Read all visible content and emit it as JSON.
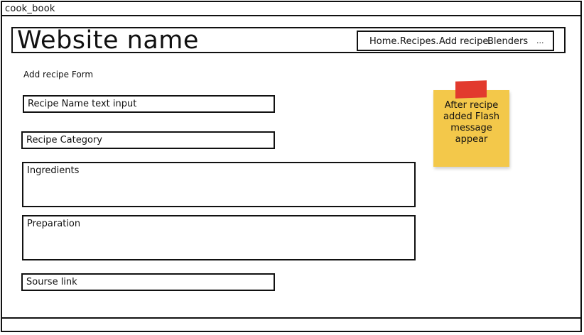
{
  "window": {
    "title": "cook_book"
  },
  "header": {
    "site_name": "Website name",
    "nav": [
      {
        "label": "Home."
      },
      {
        "label": "Recipes."
      },
      {
        "label": "Add recipe."
      },
      {
        "label": "Blenders"
      },
      {
        "label": "..."
      }
    ]
  },
  "form": {
    "title": "Add recipe Form",
    "fields": [
      {
        "label": "Recipe Name text input"
      },
      {
        "label": "Recipe Category"
      },
      {
        "label": "Ingredients"
      },
      {
        "label": "Preparation"
      },
      {
        "label": "Sourse link"
      }
    ]
  },
  "note": {
    "text_line1": "After recipe",
    "text_line2": "added Flash",
    "text_line3": "message",
    "text_line4": "appear",
    "color": "#f3c84a",
    "tape_color": "#e23a2e"
  }
}
